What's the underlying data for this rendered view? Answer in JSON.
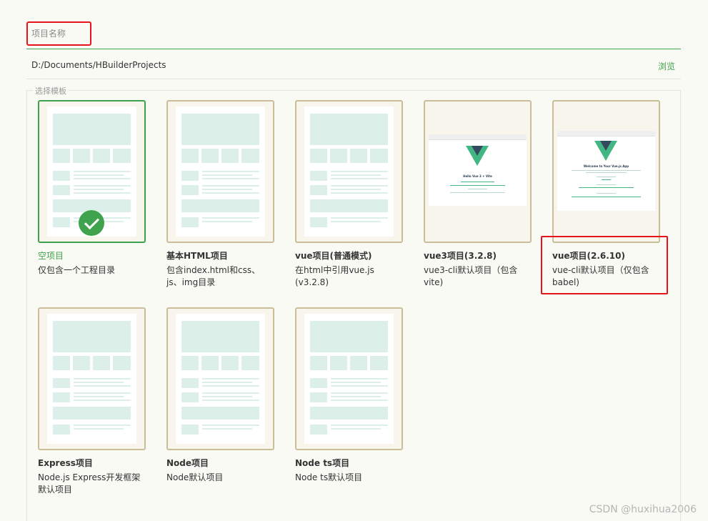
{
  "project_name": {
    "placeholder": "项目名称",
    "value": ""
  },
  "location": {
    "path": "D:/Documents/HBuilderProjects",
    "browse_label": "浏览"
  },
  "templates": {
    "legend": "选择模板",
    "items": [
      {
        "title": "空项目",
        "desc": "仅包含一个工程目录",
        "selected": true
      },
      {
        "title": "基本HTML项目",
        "desc": "包含index.html和css、js、img目录"
      },
      {
        "title": "vue项目(普通模式)",
        "desc": "在html中引用vue.js (v3.2.8)"
      },
      {
        "title": "vue3项目(3.2.8)",
        "desc": "vue3-cli默认项目（包含vite)"
      },
      {
        "title": "vue项目(2.6.10)",
        "desc": "vue-cli默认项目（仅包含babel)"
      },
      {
        "title": "Express项目",
        "desc": "Node.js Express开发框架默认项目"
      },
      {
        "title": "Node项目",
        "desc": "Node默认项目"
      },
      {
        "title": "Node ts项目",
        "desc": "Node ts默认项目"
      }
    ]
  },
  "previews": {
    "vue3": {
      "heading": "Hello Vue 3 + Vite"
    },
    "vue2": {
      "heading": "Welcome to Your Vue.js App"
    }
  },
  "colors": {
    "accent": "#3fa34d",
    "card_border": "#c9bd9a",
    "highlight": "#e8141b",
    "placeholder_fill": "#ddefe9"
  },
  "watermark": "CSDN @huxihua2006"
}
